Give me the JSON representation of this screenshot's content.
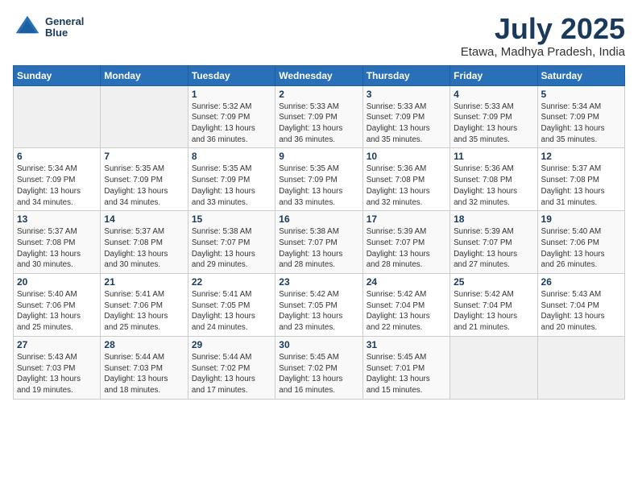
{
  "header": {
    "logo_line1": "General",
    "logo_line2": "Blue",
    "month_year": "July 2025",
    "location": "Etawa, Madhya Pradesh, India"
  },
  "days_of_week": [
    "Sunday",
    "Monday",
    "Tuesday",
    "Wednesday",
    "Thursday",
    "Friday",
    "Saturday"
  ],
  "weeks": [
    [
      {
        "day": "",
        "info": ""
      },
      {
        "day": "",
        "info": ""
      },
      {
        "day": "1",
        "info": "Sunrise: 5:32 AM\nSunset: 7:09 PM\nDaylight: 13 hours\nand 36 minutes."
      },
      {
        "day": "2",
        "info": "Sunrise: 5:33 AM\nSunset: 7:09 PM\nDaylight: 13 hours\nand 36 minutes."
      },
      {
        "day": "3",
        "info": "Sunrise: 5:33 AM\nSunset: 7:09 PM\nDaylight: 13 hours\nand 35 minutes."
      },
      {
        "day": "4",
        "info": "Sunrise: 5:33 AM\nSunset: 7:09 PM\nDaylight: 13 hours\nand 35 minutes."
      },
      {
        "day": "5",
        "info": "Sunrise: 5:34 AM\nSunset: 7:09 PM\nDaylight: 13 hours\nand 35 minutes."
      }
    ],
    [
      {
        "day": "6",
        "info": "Sunrise: 5:34 AM\nSunset: 7:09 PM\nDaylight: 13 hours\nand 34 minutes."
      },
      {
        "day": "7",
        "info": "Sunrise: 5:35 AM\nSunset: 7:09 PM\nDaylight: 13 hours\nand 34 minutes."
      },
      {
        "day": "8",
        "info": "Sunrise: 5:35 AM\nSunset: 7:09 PM\nDaylight: 13 hours\nand 33 minutes."
      },
      {
        "day": "9",
        "info": "Sunrise: 5:35 AM\nSunset: 7:09 PM\nDaylight: 13 hours\nand 33 minutes."
      },
      {
        "day": "10",
        "info": "Sunrise: 5:36 AM\nSunset: 7:08 PM\nDaylight: 13 hours\nand 32 minutes."
      },
      {
        "day": "11",
        "info": "Sunrise: 5:36 AM\nSunset: 7:08 PM\nDaylight: 13 hours\nand 32 minutes."
      },
      {
        "day": "12",
        "info": "Sunrise: 5:37 AM\nSunset: 7:08 PM\nDaylight: 13 hours\nand 31 minutes."
      }
    ],
    [
      {
        "day": "13",
        "info": "Sunrise: 5:37 AM\nSunset: 7:08 PM\nDaylight: 13 hours\nand 30 minutes."
      },
      {
        "day": "14",
        "info": "Sunrise: 5:37 AM\nSunset: 7:08 PM\nDaylight: 13 hours\nand 30 minutes."
      },
      {
        "day": "15",
        "info": "Sunrise: 5:38 AM\nSunset: 7:07 PM\nDaylight: 13 hours\nand 29 minutes."
      },
      {
        "day": "16",
        "info": "Sunrise: 5:38 AM\nSunset: 7:07 PM\nDaylight: 13 hours\nand 28 minutes."
      },
      {
        "day": "17",
        "info": "Sunrise: 5:39 AM\nSunset: 7:07 PM\nDaylight: 13 hours\nand 28 minutes."
      },
      {
        "day": "18",
        "info": "Sunrise: 5:39 AM\nSunset: 7:07 PM\nDaylight: 13 hours\nand 27 minutes."
      },
      {
        "day": "19",
        "info": "Sunrise: 5:40 AM\nSunset: 7:06 PM\nDaylight: 13 hours\nand 26 minutes."
      }
    ],
    [
      {
        "day": "20",
        "info": "Sunrise: 5:40 AM\nSunset: 7:06 PM\nDaylight: 13 hours\nand 25 minutes."
      },
      {
        "day": "21",
        "info": "Sunrise: 5:41 AM\nSunset: 7:06 PM\nDaylight: 13 hours\nand 25 minutes."
      },
      {
        "day": "22",
        "info": "Sunrise: 5:41 AM\nSunset: 7:05 PM\nDaylight: 13 hours\nand 24 minutes."
      },
      {
        "day": "23",
        "info": "Sunrise: 5:42 AM\nSunset: 7:05 PM\nDaylight: 13 hours\nand 23 minutes."
      },
      {
        "day": "24",
        "info": "Sunrise: 5:42 AM\nSunset: 7:04 PM\nDaylight: 13 hours\nand 22 minutes."
      },
      {
        "day": "25",
        "info": "Sunrise: 5:42 AM\nSunset: 7:04 PM\nDaylight: 13 hours\nand 21 minutes."
      },
      {
        "day": "26",
        "info": "Sunrise: 5:43 AM\nSunset: 7:04 PM\nDaylight: 13 hours\nand 20 minutes."
      }
    ],
    [
      {
        "day": "27",
        "info": "Sunrise: 5:43 AM\nSunset: 7:03 PM\nDaylight: 13 hours\nand 19 minutes."
      },
      {
        "day": "28",
        "info": "Sunrise: 5:44 AM\nSunset: 7:03 PM\nDaylight: 13 hours\nand 18 minutes."
      },
      {
        "day": "29",
        "info": "Sunrise: 5:44 AM\nSunset: 7:02 PM\nDaylight: 13 hours\nand 17 minutes."
      },
      {
        "day": "30",
        "info": "Sunrise: 5:45 AM\nSunset: 7:02 PM\nDaylight: 13 hours\nand 16 minutes."
      },
      {
        "day": "31",
        "info": "Sunrise: 5:45 AM\nSunset: 7:01 PM\nDaylight: 13 hours\nand 15 minutes."
      },
      {
        "day": "",
        "info": ""
      },
      {
        "day": "",
        "info": ""
      }
    ]
  ]
}
